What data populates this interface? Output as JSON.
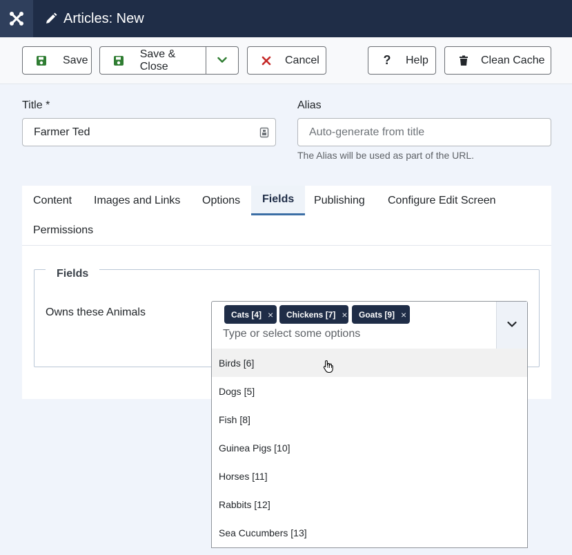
{
  "header": {
    "title": "Articles: New"
  },
  "toolbar": {
    "save": "Save",
    "save_close": "Save & Close",
    "cancel": "Cancel",
    "help": "Help",
    "clean_cache": "Clean Cache"
  },
  "form": {
    "title_label": "Title *",
    "title_value": "Farmer Ted",
    "alias_label": "Alias",
    "alias_placeholder": "Auto-generate from title",
    "alias_hint": "The Alias will be used as part of the URL."
  },
  "tabs": [
    {
      "label": "Content"
    },
    {
      "label": "Images and Links"
    },
    {
      "label": "Options"
    },
    {
      "label": "Fields",
      "active": true
    },
    {
      "label": "Publishing"
    },
    {
      "label": "Configure Edit Screen"
    },
    {
      "label": "Permissions"
    }
  ],
  "fields": {
    "legend": "Fields",
    "label": "Owns these Animals",
    "selected": [
      "Cats [4]",
      "Chickens [7]",
      "Goats [9]"
    ],
    "remove_glyph": "×",
    "placeholder": "Type or select some options",
    "options": [
      "Birds [6]",
      "Dogs [5]",
      "Fish [8]",
      "Guinea Pigs [10]",
      "Horses [11]",
      "Rabbits [12]",
      "Sea Cucumbers [13]"
    ],
    "highlighted_option": "Birds [6]"
  },
  "colors": {
    "header_bg": "#1f2d47",
    "chip_bg": "#1f2d47",
    "save_icon": "#2f7d32",
    "cancel_icon": "#c52827"
  }
}
